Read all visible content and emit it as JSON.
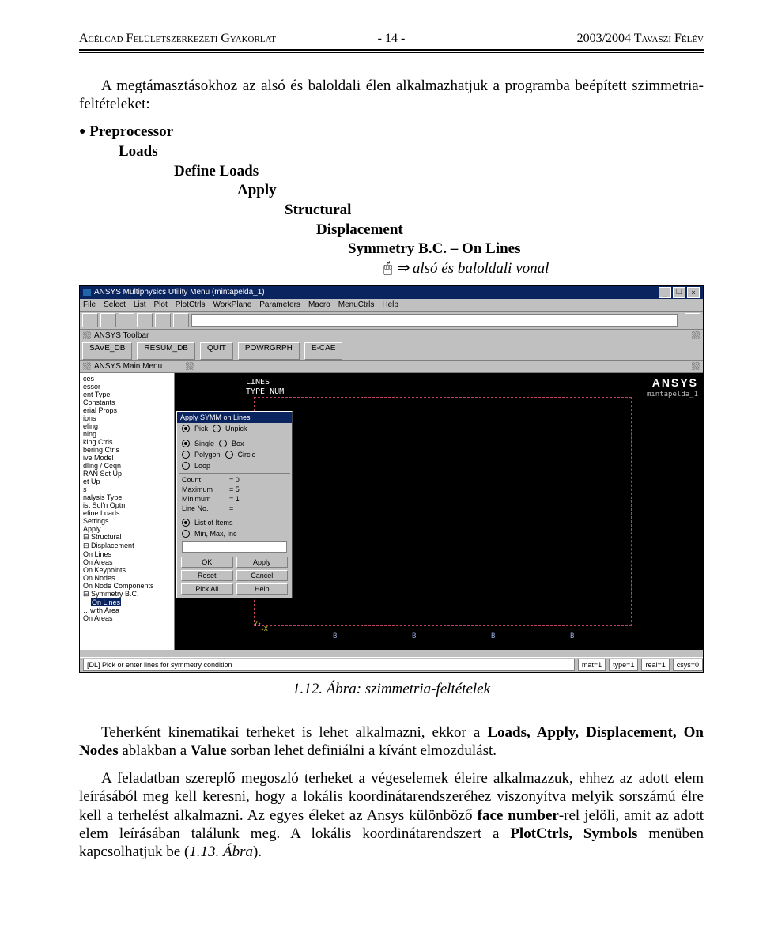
{
  "header": {
    "left": "Acélcad Felületszerkezeti Gyakorlat",
    "center": "- 14 -",
    "right": "2003/2004 Tavaszi Félév"
  },
  "intro": "A megtámasztásokhoz az alsó és baloldali élen alkalmazhatjuk a programba beépített szimmetria-feltételeket:",
  "menu": {
    "l0": "Preprocessor",
    "l1": "Loads",
    "l2": "Define Loads",
    "l3": "Apply",
    "l4": "Structural",
    "l5": "Displacement",
    "l6": "Symmetry B.C. – On Lines",
    "cursor_note": "⇒ alsó és baloldali vonal"
  },
  "caption": "1.12. Ábra: szimmetria-feltételek",
  "para2a": "Teherként kinematikai terheket is lehet alkalmazni, ekkor a ",
  "para2b": "Loads, Apply, Displacement, On Nodes",
  "para2c": " ablakban a ",
  "para2d": "Value",
  "para2e": " sorban lehet definiálni a kívánt elmozdulást.",
  "para3a": "A feladatban szereplő megoszló terheket a végeselemek éleire alkalmazzuk, ehhez az adott elem leírásából meg kell keresni, hogy a lokális koordinátarendszeréhez viszonyítva melyik sorszámú élre kell a terhelést alkalmazni. Az egyes éleket az Ansys különböző ",
  "para3b": "face number",
  "para3c": "-rel jelöli, amit az adott elem leírásában találunk meg. A lokális koordinátarendszert a ",
  "para3d": "PlotCtrls, Symbols",
  "para3e": " menüben kapcsolhatjuk be (",
  "para3f": "1.13. Ábra",
  "para3g": ").",
  "ansys": {
    "title": "ANSYS Multiphysics Utility Menu (mintapelda_1)",
    "menus": [
      "File",
      "Select",
      "List",
      "Plot",
      "PlotCtrls",
      "WorkPlane",
      "Parameters",
      "Macro",
      "MenuCtrls",
      "Help"
    ],
    "toolbar_band": "ANSYS Toolbar",
    "toolbar_buttons": [
      "SAVE_DB",
      "RESUM_DB",
      "QUIT",
      "POWRGRPH",
      "E-CAE"
    ],
    "mainmenu_band": "ANSYS Main Menu",
    "tree": [
      "ces",
      "essor",
      "ent Type",
      "Constants",
      "erial Props",
      "ions",
      "eling",
      "ning",
      "king Ctrls",
      "bering Ctrls",
      "ive Model",
      "dling / Ceqn",
      "RAN Set Up",
      "et Up",
      "s",
      "nalysis Type",
      "ist Sol'n Optn",
      "efine Loads",
      "Settings",
      "Apply",
      "⊟ Structural",
      "  ⊟ Displacement",
      "    On Lines",
      "    On Areas",
      "    On Keypoints",
      "    On Nodes",
      "    On Node Components",
      "  ⊟ Symmetry B.C.",
      "    …with Area",
      "    On Areas"
    ],
    "tree_selected": "On Lines",
    "viewport": {
      "line1": "LINES",
      "line2": "TYPE NUM",
      "logo": "ANSYS",
      "sub": "mintapelda_1",
      "bvals": [
        "B",
        "B",
        "B",
        "B"
      ]
    },
    "popup": {
      "title": "Apply SYMM on Lines",
      "pick": "Pick",
      "unpick": "Unpick",
      "single": "Single",
      "box": "Box",
      "polygon": "Polygon",
      "circle": "Circle",
      "loop": "Loop",
      "count_l": "Count",
      "count_v": "=   0",
      "max_l": "Maximum",
      "max_v": "=   5",
      "min_l": "Minimum",
      "min_v": "=   1",
      "line_l": "Line No.",
      "line_v": "=",
      "list": "List of Items",
      "minmax": "Min, Max, Inc",
      "btns1": [
        "OK",
        "Apply"
      ],
      "btns2": [
        "Reset",
        "Cancel"
      ],
      "btns3": [
        "Pick All",
        "Help"
      ]
    },
    "status": {
      "prompt": "[DL]  Pick or enter lines for symmetry condition",
      "cells": [
        "mat=1",
        "type=1",
        "real=1",
        "csys=0"
      ]
    }
  }
}
